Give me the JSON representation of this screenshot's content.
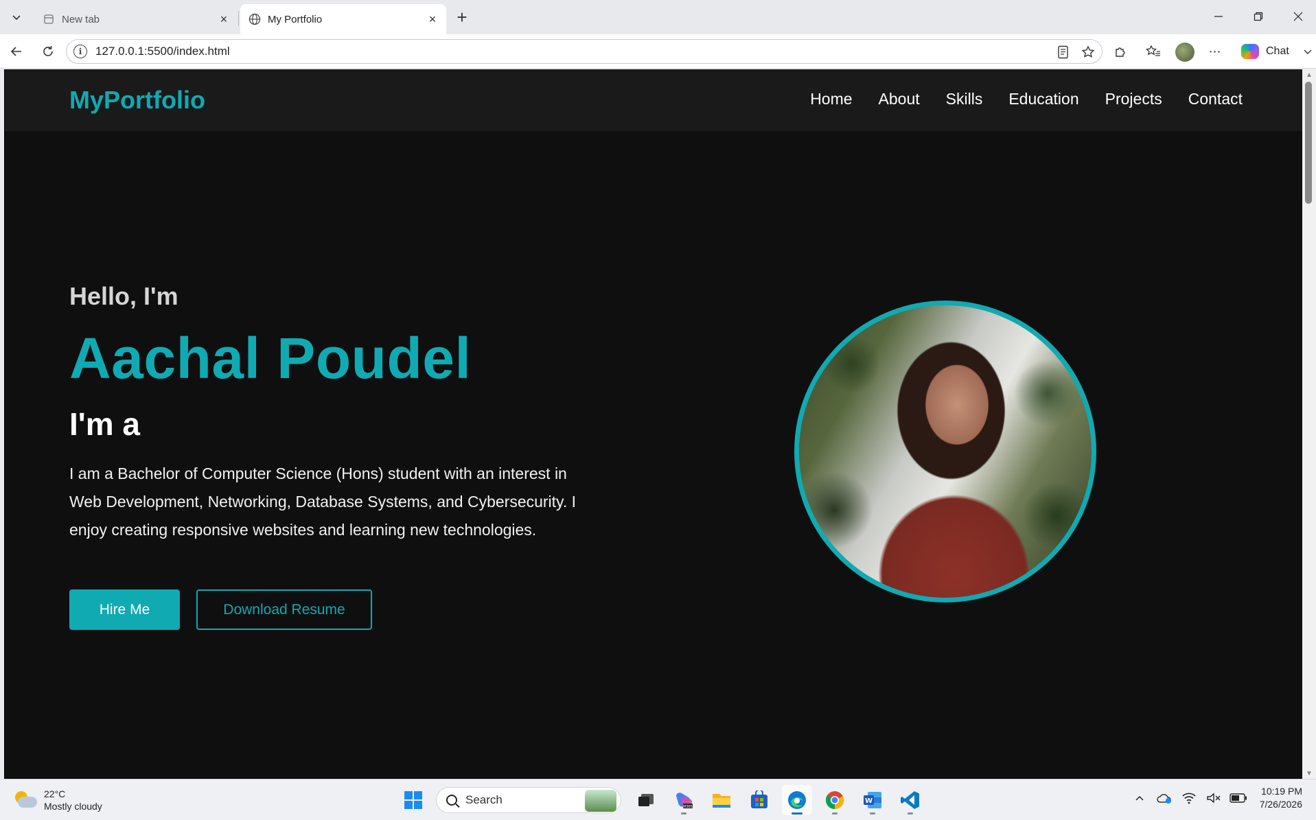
{
  "browser": {
    "tabs": [
      {
        "title": "New tab",
        "active": false
      },
      {
        "title": "My Portfolio",
        "active": true
      }
    ],
    "address": "127.0.0.1:5500/index.html",
    "chat_label": "Chat"
  },
  "page": {
    "brand": "MyPortfolio",
    "nav": [
      "Home",
      "About",
      "Skills",
      "Education",
      "Projects",
      "Contact"
    ],
    "greeting": "Hello, I'm",
    "name": "Aachal Poudel",
    "role": "I'm a",
    "description": "I am a Bachelor of Computer Science (Hons) student with an interest in Web Development, Networking, Database Systems, and Cybersecurity. I enjoy creating responsive websites and learning new technologies.",
    "buttons": {
      "hire": "Hire Me",
      "resume": "Download Resume"
    },
    "accent_color": "#10aab3",
    "background_color": "#0f0f10",
    "nav_background": "#1a1a1b"
  },
  "taskbar": {
    "weather_temp": "22°C",
    "weather_desc": "Mostly cloudy",
    "search_placeholder": "Search",
    "time": "10:19 PM",
    "date": "7/26/2026",
    "apps": [
      "task-view-icon",
      "m365-copilot-icon",
      "file-explorer-icon",
      "microsoft-store-icon",
      "edge-icon",
      "chrome-icon",
      "word-icon",
      "vscode-icon"
    ]
  }
}
